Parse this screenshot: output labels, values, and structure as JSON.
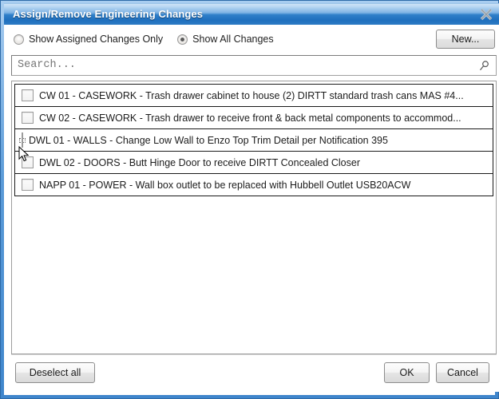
{
  "window": {
    "title": "Assign/Remove Engineering Changes",
    "close_icon": "close-x-icon",
    "accent_color": "#2f7fc9",
    "border_color": "#3f86cc"
  },
  "options": {
    "radios": [
      {
        "label": "Show Assigned Changes Only",
        "selected": false
      },
      {
        "label": "Show All Changes",
        "selected": true
      }
    ],
    "new_button": "New..."
  },
  "search": {
    "value": "",
    "placeholder": "Search...",
    "icon": "magnifier-icon"
  },
  "list": {
    "rows": [
      {
        "label": "CW 01 - CASEWORK - Trash drawer cabinet to house (2) DIRTT standard trash cans MAS #4...",
        "checked": false,
        "focused": false
      },
      {
        "label": "CW 02 - CASEWORK - Trash drawer to receive front & back metal components to accommod...",
        "checked": false,
        "focused": false
      },
      {
        "label": "DWL 01 - WALLS - Change Low Wall to Enzo Top Trim Detail per Notification 395",
        "checked": false,
        "focused": true
      },
      {
        "label": "DWL 02 - DOORS - Butt Hinge Door to receive DIRTT Concealed Closer",
        "checked": false,
        "focused": false
      },
      {
        "label": "NAPP 01 - POWER - Wall box outlet to be replaced with Hubbell Outlet USB20ACW",
        "checked": false,
        "focused": false
      }
    ]
  },
  "footer": {
    "deselect_all": "Deselect all",
    "ok": "OK",
    "cancel": "Cancel"
  },
  "cursor": {
    "icon": "mouse-pointer-icon"
  }
}
